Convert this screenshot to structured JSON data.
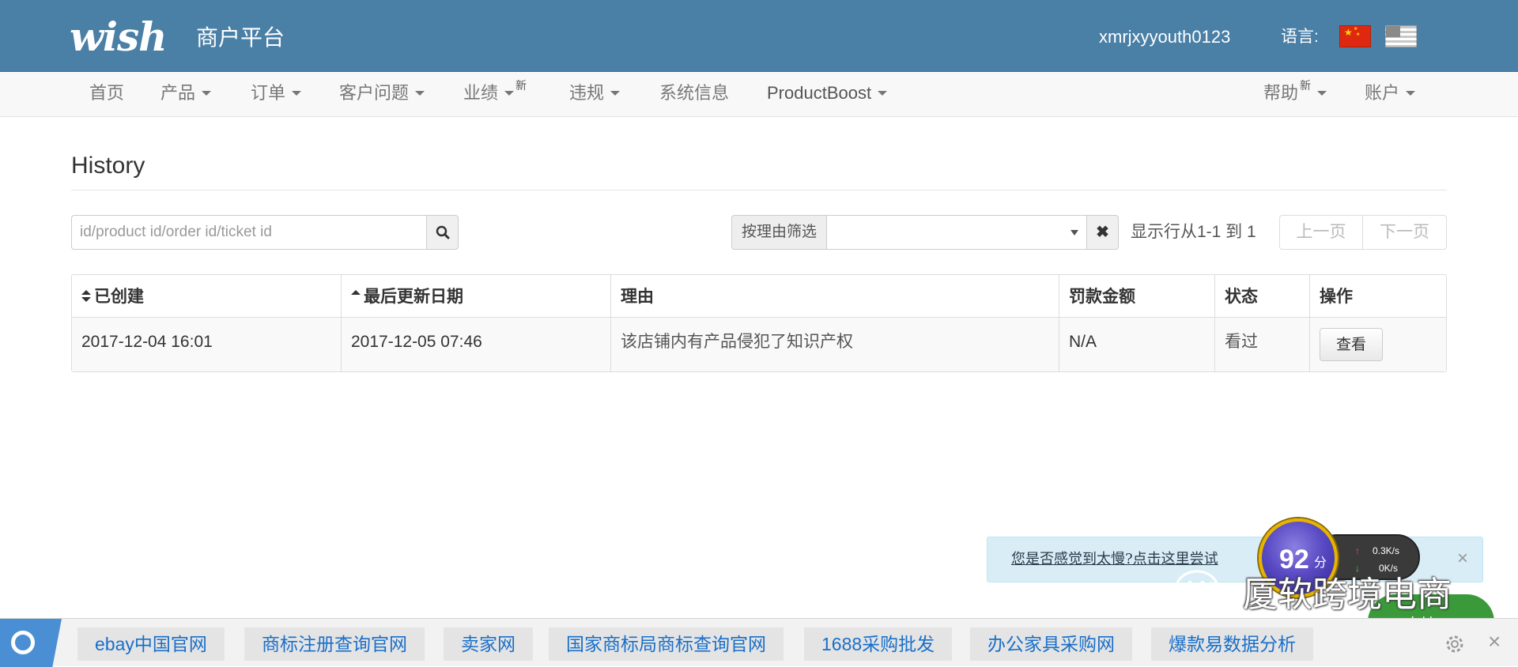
{
  "header": {
    "logo_text": "wish",
    "platform_title": "商户平台",
    "username": "xmrjxyyouth0123",
    "language_label": "语言:"
  },
  "nav": {
    "items": [
      {
        "label": "首页"
      },
      {
        "label": "产品"
      },
      {
        "label": "订单"
      },
      {
        "label": "客户问题"
      },
      {
        "label": "业绩"
      },
      {
        "label": "违规"
      },
      {
        "label": "系统信息"
      },
      {
        "label": "ProductBoost"
      }
    ],
    "new_badge": "新",
    "help_label": "帮助",
    "account_label": "账户"
  },
  "page": {
    "title": "History"
  },
  "search": {
    "placeholder": "id/product id/order id/ticket id",
    "value": ""
  },
  "filter": {
    "label": "按理由筛选",
    "selected": "",
    "rows_info": "显示行从1-1 到 1",
    "prev_label": "上一页",
    "next_label": "下一页"
  },
  "table": {
    "headers": [
      "已创建",
      "最后更新日期",
      "理由",
      "罚款金额",
      "状态",
      "操作"
    ],
    "rows": [
      {
        "created": "2017-12-04 16:01",
        "updated": "2017-12-05 07:46",
        "reason": "该店铺内有产品侵犯了知识产权",
        "fine": "N/A",
        "status": "看过",
        "action": "查看"
      }
    ]
  },
  "notice": {
    "text": "您是否感觉到太慢?点击这里尝试",
    "close": "×"
  },
  "speed_widget": {
    "score": "92",
    "score_unit": "分",
    "upload": "0.3K/s",
    "download": "0K/s"
  },
  "watermark": {
    "text": "厦软跨境电商",
    "support": "支持"
  },
  "bookmarks": [
    "ebay中国官网",
    "商标注册查询官网",
    "卖家网",
    "国家商标局商标查询官网",
    "1688采购批发",
    "办公家具采购网",
    "爆款易数据分析"
  ],
  "bookmarks_close": "×",
  "colors": {
    "header_bg": "#4a7fa6",
    "nav_bg": "#f8f8f8",
    "notice_bg": "#d9edf7",
    "link_blue": "#1a6fc9"
  }
}
